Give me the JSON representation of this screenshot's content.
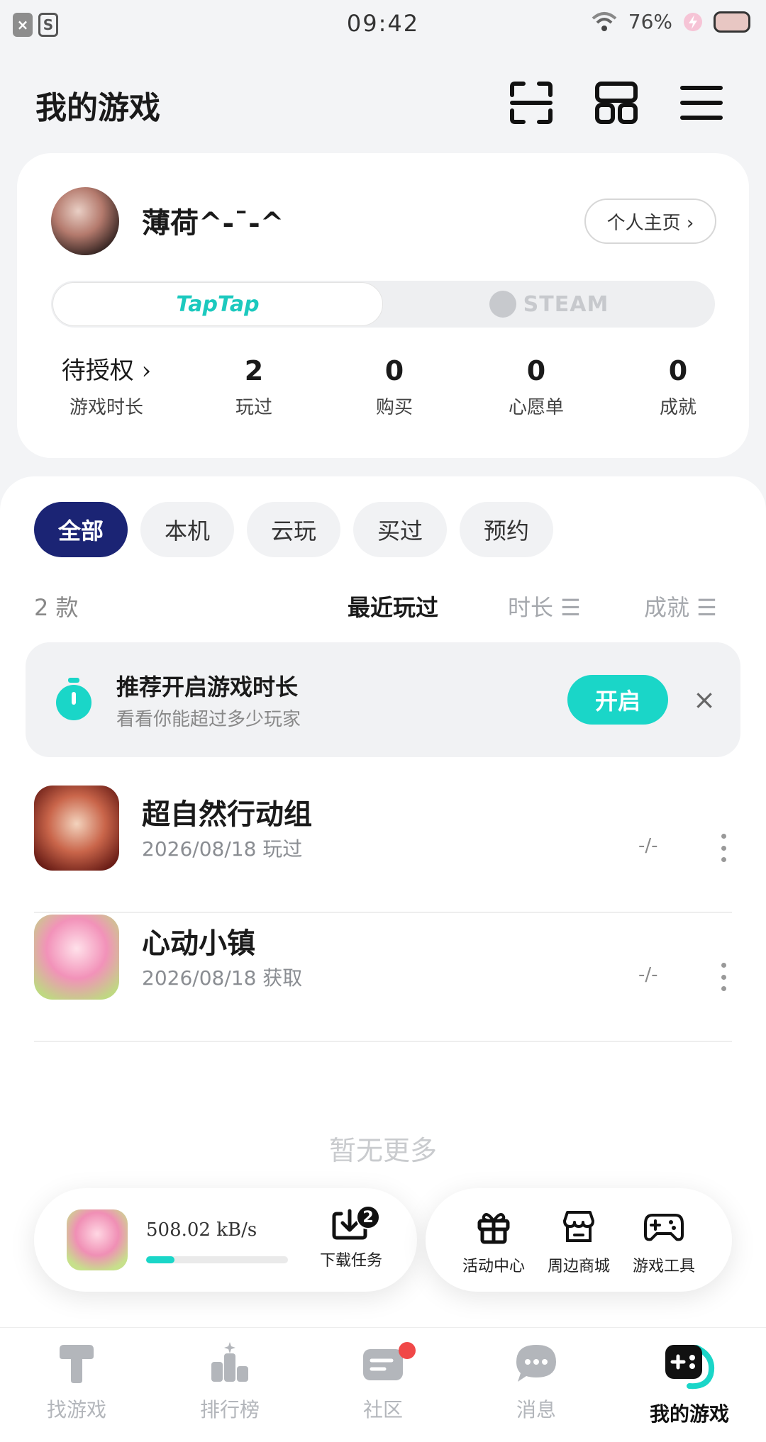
{
  "status_bar": {
    "time": "09:42",
    "battery": "76%",
    "left_icons": [
      "×",
      "S"
    ]
  },
  "header": {
    "title": "我的游戏",
    "icons": [
      "scan-icon",
      "grid-icon",
      "menu-icon"
    ]
  },
  "profile": {
    "username": "薄荷^-ˉ-^",
    "homepage_label": "个人主页 ›",
    "platform_tabs": [
      "TapTap",
      "STEAM"
    ],
    "active_platform": "TapTap",
    "stats": [
      {
        "value": "待授权 ›",
        "label": "游戏时长"
      },
      {
        "value": "2",
        "label": "玩过"
      },
      {
        "value": "0",
        "label": "购买"
      },
      {
        "value": "0",
        "label": "心愿单"
      },
      {
        "value": "0",
        "label": "成就"
      }
    ]
  },
  "filters": {
    "chips": [
      "全部",
      "本机",
      "云玩",
      "买过",
      "预约"
    ],
    "active": "全部"
  },
  "sort": {
    "count": "2 款",
    "options": [
      "最近玩过",
      "时长 ☰",
      "成就 ☰"
    ],
    "active": "最近玩过"
  },
  "recommend": {
    "title": "推荐开启游戏时长",
    "subtitle": "看看你能超过多少玩家",
    "button": "开启",
    "close": "×"
  },
  "games": [
    {
      "name": "超自然行动组",
      "date": "2026/08/18 玩过",
      "time": "-/-",
      "icon": "game-icon-supernatural"
    },
    {
      "name": "心动小镇",
      "date": "2026/08/18 获取",
      "time": "-/-",
      "icon": "game-icon-heartopia"
    }
  ],
  "no_more": "暂无更多",
  "download": {
    "speed": "508.02 kB/s",
    "progress": 0.2,
    "task_label": "下载任务",
    "task_count": "2"
  },
  "tools": [
    {
      "label": "活动中心",
      "icon": "gift-icon"
    },
    {
      "label": "周边商城",
      "icon": "shop-icon"
    },
    {
      "label": "游戏工具",
      "icon": "gamepad-icon"
    }
  ],
  "bottom_nav": [
    {
      "label": "找游戏",
      "icon": "find-game-icon"
    },
    {
      "label": "排行榜",
      "icon": "ranking-icon"
    },
    {
      "label": "社区",
      "icon": "community-icon"
    },
    {
      "label": "消息",
      "icon": "message-icon"
    },
    {
      "label": "我的游戏",
      "icon": "my-games-icon"
    }
  ],
  "colors": {
    "accent": "#1ad6c8",
    "chip_active": "#1b2474",
    "notify": "#f04848"
  }
}
